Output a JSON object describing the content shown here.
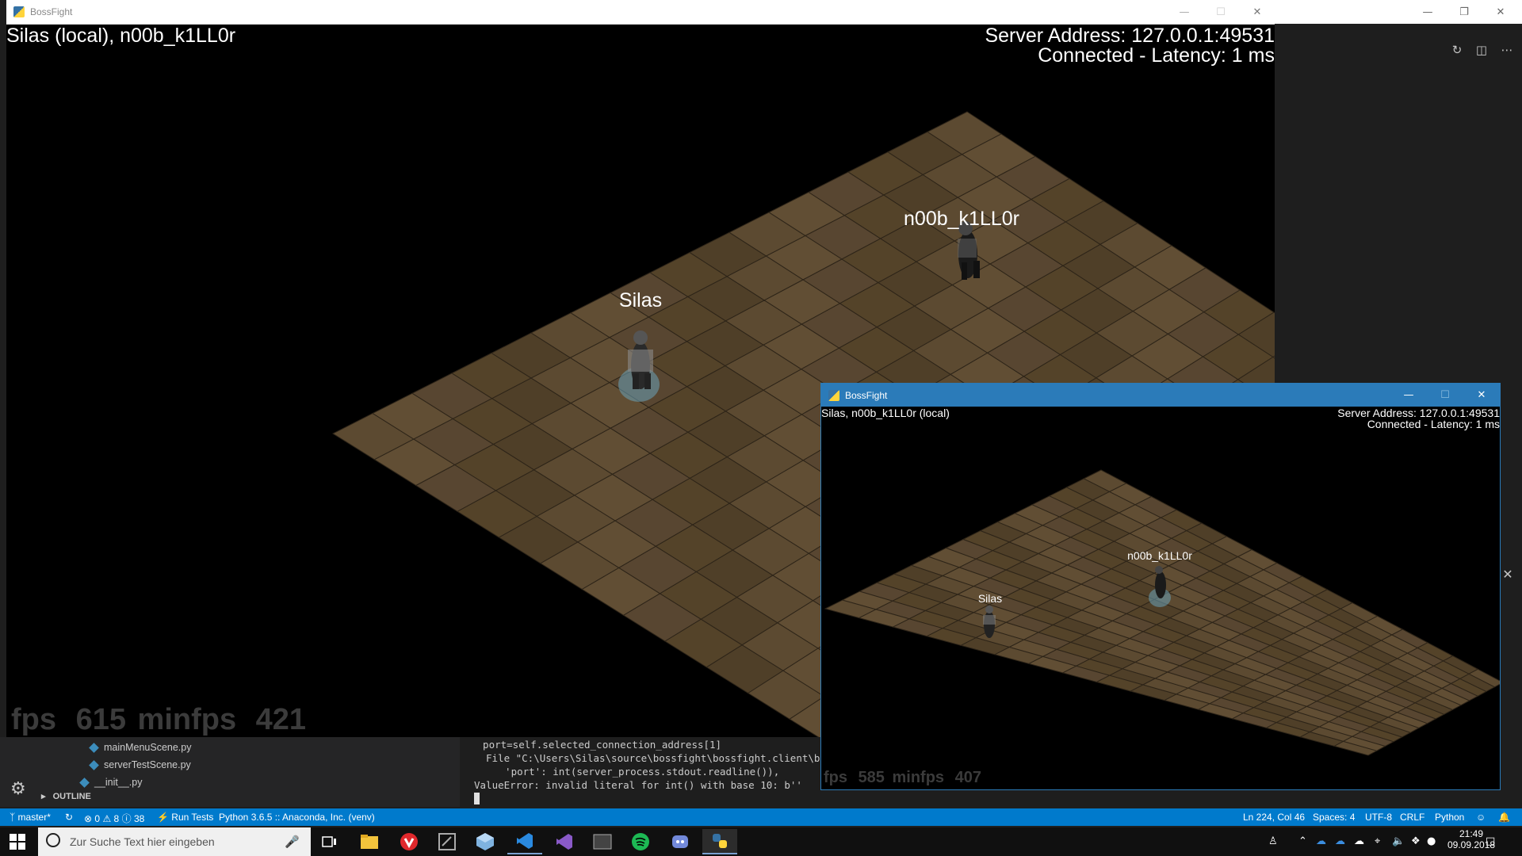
{
  "main_window": {
    "title": "BossFight",
    "hud_players": "Silas (local), n00b_k1LL0r",
    "server_address": "Server Address: 127.0.0.1:49531",
    "connection": "Connected - Latency: 1 ms",
    "fps_label": "fps",
    "fps_value": "615",
    "minfps_label": "minfps",
    "minfps_value": "421",
    "player_labels": [
      "Silas",
      "n00b_k1LL0r"
    ]
  },
  "second_window": {
    "title": "BossFight",
    "hud_players": "Silas, n00b_k1LL0r (local)",
    "server_address": "Server Address: 127.0.0.1:49531",
    "connection": "Connected - Latency: 1 ms",
    "fps_label": "fps",
    "fps_value": "585",
    "minfps_label": "minfps",
    "minfps_value": "407",
    "player_labels": [
      "Silas",
      "n00b_k1LL0r"
    ]
  },
  "explorer": {
    "items": [
      "mainMenuScene.py",
      "serverTestScene.py",
      "__init__.py"
    ],
    "outline_label": "OUTLINE"
  },
  "terminal": {
    "lines": [
      "  port=self.selected_connection_address[1]",
      "File \"C:\\Users\\Silas\\source\\bossfight\\bossfight.client\\bossf",
      "  'port': int(server_process.stdout.readline()),",
      "ValueError: invalid literal for int() with base 10: b''"
    ]
  },
  "statusbar": {
    "branch": "master*",
    "errors": "0",
    "warnings": "8",
    "infos": "38",
    "run_tests": "Run Tests",
    "interpreter": "Python 3.6.5 :: Anaconda, Inc. (venv)",
    "position": "Ln 224, Col 46",
    "spaces": "Spaces: 4",
    "encoding": "UTF-8",
    "eol": "CRLF",
    "language": "Python"
  },
  "taskbar": {
    "search_placeholder": "Zur Suche Text hier eingeben",
    "time": "21:49",
    "date": "09.09.2018",
    "apps": [
      "task-view-icon",
      "file-explorer-icon",
      "vivaldi-icon",
      "gitkraken-icon",
      "virtualbox-icon",
      "vscode-icon",
      "visual-studio-icon",
      "terminal-icon",
      "spotify-icon",
      "discord-icon",
      "python-icon"
    ]
  }
}
